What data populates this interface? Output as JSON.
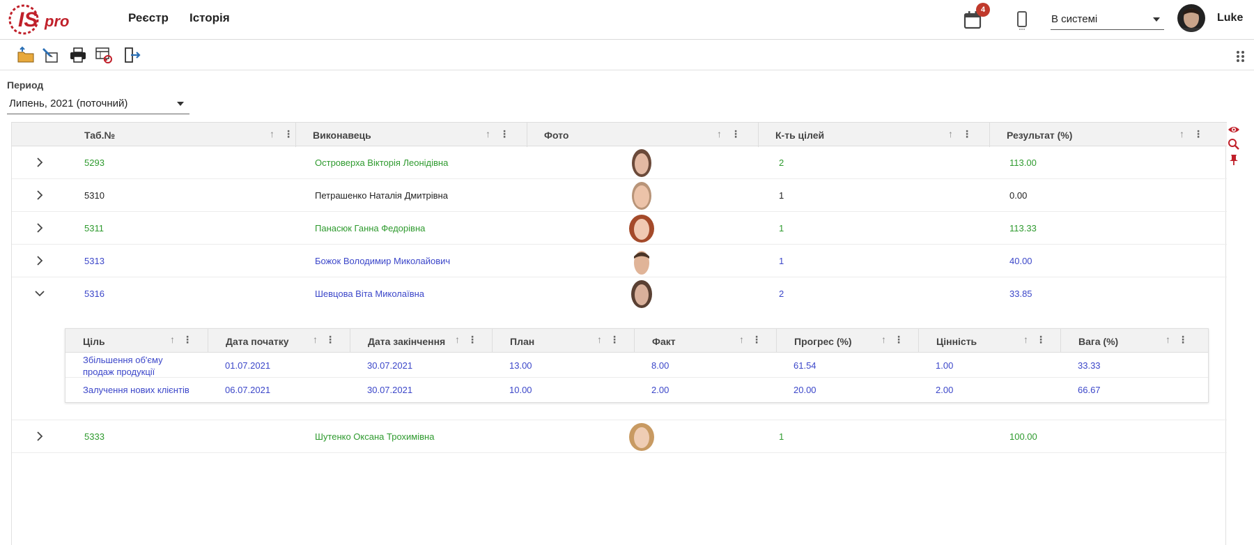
{
  "app": {
    "nav": [
      "Реєстр",
      "Історія"
    ],
    "notifications_count": "4",
    "status_value": "В системі",
    "user_name": "Luke",
    "brand_color": "#c0202a"
  },
  "period": {
    "label": "Период",
    "value": "Липень, 2021 (поточний)"
  },
  "grid": {
    "headers": [
      "Таб.№",
      "Виконавець",
      "Фото",
      "К-ть цілей",
      "Результат (%)"
    ],
    "rows": [
      {
        "tab": "5293",
        "name": "Островерха Вікторія Леонідівна",
        "goals": "2",
        "result": "113.00",
        "color": "green",
        "expanded": false
      },
      {
        "tab": "5310",
        "name": "Петрашенко Наталія Дмитрівна",
        "goals": "1",
        "result": "0.00",
        "color": "black",
        "expanded": false
      },
      {
        "tab": "5311",
        "name": "Панасюк Ганна Федорівна",
        "goals": "1",
        "result": "113.33",
        "color": "green",
        "expanded": false
      },
      {
        "tab": "5313",
        "name": "Божок Володимир Миколайович",
        "goals": "1",
        "result": "40.00",
        "color": "blue",
        "expanded": false
      },
      {
        "tab": "5316",
        "name": "Шевцова Віта Миколаївна",
        "goals": "2",
        "result": "33.85",
        "color": "blue",
        "expanded": true
      },
      {
        "tab": "5333",
        "name": "Шутенко Оксана Трохимівна",
        "goals": "1",
        "result": "100.00",
        "color": "green",
        "expanded": false
      }
    ]
  },
  "subgrid": {
    "headers": [
      "Ціль",
      "Дата початку",
      "Дата закінчення",
      "План",
      "Факт",
      "Прогрес (%)",
      "Цінність",
      "Вага (%)"
    ],
    "rows": [
      {
        "goal_line1": "Збільшення об'єму",
        "goal_line2": "продаж продукції",
        "start": "01.07.2021",
        "end": "30.07.2021",
        "plan": "13.00",
        "fact": "8.00",
        "progress": "61.54",
        "value": "1.00",
        "weight": "33.33"
      },
      {
        "goal_line1": "Залучення нових клієнтів",
        "goal_line2": "",
        "start": "06.07.2021",
        "end": "30.07.2021",
        "plan": "10.00",
        "fact": "2.00",
        "progress": "20.00",
        "value": "2.00",
        "weight": "66.67"
      }
    ]
  },
  "icons": {
    "toolbar": [
      "open-folder-icon",
      "edit-icon",
      "print-icon",
      "refresh-table-icon",
      "exit-icon"
    ],
    "side": [
      "eye-icon",
      "search-icon",
      "pin-icon"
    ]
  }
}
